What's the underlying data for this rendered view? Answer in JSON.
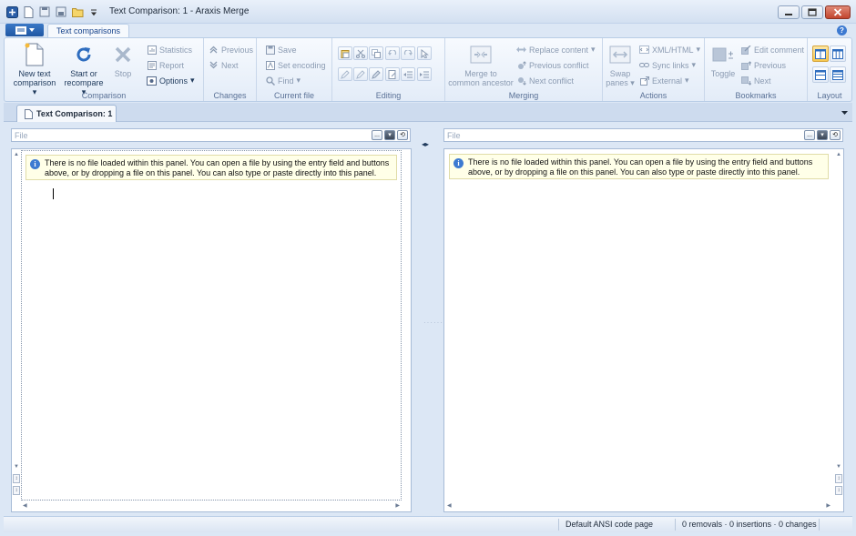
{
  "app": {
    "title": "Text Comparison: 1 - Araxis Merge"
  },
  "quick_access": {
    "icons": [
      "app-icon",
      "new-file-icon",
      "save-icon",
      "save-all-icon",
      "open-folder-icon",
      "customize-dropdown-icon"
    ]
  },
  "ribbon": {
    "tab": "Text comparisons",
    "groups": {
      "comparison": {
        "label": "Comparison",
        "new_text": [
          "New text",
          "comparison"
        ],
        "start": [
          "Start or",
          "recompare"
        ],
        "stop": "Stop",
        "statistics": "Statistics",
        "report": "Report",
        "options": "Options"
      },
      "changes": {
        "label": "Changes",
        "previous": "Previous",
        "next": "Next"
      },
      "current_file": {
        "label": "Current file",
        "save": "Save",
        "set_encoding": "Set encoding",
        "find": "Find"
      },
      "editing": {
        "label": "Editing"
      },
      "merging": {
        "label": "Merging",
        "merge": [
          "Merge to",
          "common ancestor"
        ],
        "replace_content": "Replace content",
        "previous_conflict": "Previous conflict",
        "next_conflict": "Next conflict"
      },
      "actions": {
        "label": "Actions",
        "swap": [
          "Swap",
          "panes"
        ],
        "xml_html": "XML/HTML",
        "sync_links": "Sync links",
        "external": "External"
      },
      "bookmarks": {
        "label": "Bookmarks",
        "toggle": "Toggle",
        "edit_comment": "Edit comment",
        "previous": "Previous",
        "next": "Next"
      },
      "layout": {
        "label": "Layout"
      }
    }
  },
  "document_tab": {
    "label": "Text Comparison: 1"
  },
  "panels": {
    "left": {
      "file_placeholder": "File",
      "browse": "...",
      "message": "There is no file loaded within this panel. You can open a file by using the entry field and buttons above, or by dropping a file on this panel. You can also type or paste directly into this panel."
    },
    "right": {
      "file_placeholder": "File",
      "browse": "...",
      "message": "There is no file loaded within this panel. You can open a file by using the entry field and buttons above, or by dropping a file on this panel. You can also type or paste directly into this panel."
    }
  },
  "status": {
    "encoding": "Default ANSI code page",
    "summary": "0 removals · 0 insertions · 0 changes"
  }
}
